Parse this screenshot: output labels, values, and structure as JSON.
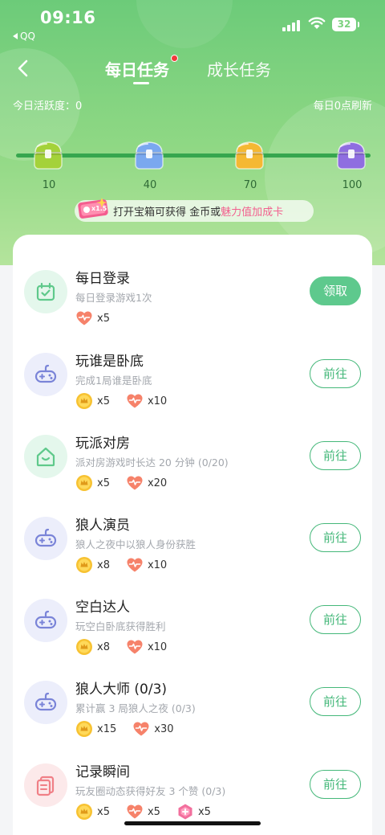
{
  "status_bar": {
    "time": "09:16",
    "back_app": "QQ",
    "battery": "32"
  },
  "nav": {
    "back_icon": "chevron-left-icon",
    "tabs": [
      {
        "label": "每日任务",
        "active": true,
        "badge_dot": true
      },
      {
        "label": "成长任务",
        "active": false
      }
    ]
  },
  "activity": {
    "label": "今日活跃度：0",
    "refresh": "每日0点刷新"
  },
  "progress": {
    "value": 0,
    "milestones": [
      {
        "value": "10",
        "chest_color": "#a4d23a"
      },
      {
        "value": "40",
        "chest_color": "#7aa8ef"
      },
      {
        "value": "70",
        "chest_color": "#f5b833"
      },
      {
        "value": "100",
        "chest_color": "#8f6ee0"
      }
    ]
  },
  "promo": {
    "card_text": "x1.5",
    "prefix": "打开宝箱可获得 金币或",
    "highlight": "魅力值加成卡"
  },
  "tasks": [
    {
      "title": "每日登录",
      "desc": "每日登录游戏1次",
      "icon": "calendar-icon",
      "icon_bg": "#e4f7ec",
      "icon_color": "#5fc98b",
      "button": "领取",
      "button_type": "claim",
      "rewards": [
        {
          "type": "heart",
          "count": "x5"
        }
      ]
    },
    {
      "title": "玩谁是卧底",
      "desc": "完成1局谁是卧底",
      "icon": "gamepad-icon",
      "icon_bg": "#eceefb",
      "icon_color": "#7a84d8",
      "button": "前往",
      "button_type": "go",
      "rewards": [
        {
          "type": "coin",
          "count": "x5"
        },
        {
          "type": "heart",
          "count": "x10"
        }
      ]
    },
    {
      "title": "玩派对房",
      "desc": "派对房游戏时长达 20 分钟 (0/20)",
      "icon": "house-icon",
      "icon_bg": "#e4f7ec",
      "icon_color": "#5fc98b",
      "button": "前往",
      "button_type": "go",
      "rewards": [
        {
          "type": "coin",
          "count": "x5"
        },
        {
          "type": "heart",
          "count": "x20"
        }
      ]
    },
    {
      "title": "狼人演员",
      "desc": "狼人之夜中以狼人身份获胜",
      "icon": "gamepad-icon",
      "icon_bg": "#eceefb",
      "icon_color": "#7a84d8",
      "button": "前往",
      "button_type": "go",
      "rewards": [
        {
          "type": "coin",
          "count": "x8"
        },
        {
          "type": "heart",
          "count": "x10"
        }
      ]
    },
    {
      "title": "空白达人",
      "desc": "玩空白卧底获得胜利",
      "icon": "gamepad-icon",
      "icon_bg": "#eceefb",
      "icon_color": "#7a84d8",
      "button": "前往",
      "button_type": "go",
      "rewards": [
        {
          "type": "coin",
          "count": "x8"
        },
        {
          "type": "heart",
          "count": "x10"
        }
      ]
    },
    {
      "title": "狼人大师 (0/3)",
      "desc": "累计赢 3 局狼人之夜 (0/3)",
      "icon": "gamepad-icon",
      "icon_bg": "#eceefb",
      "icon_color": "#7a84d8",
      "button": "前往",
      "button_type": "go",
      "rewards": [
        {
          "type": "coin",
          "count": "x15"
        },
        {
          "type": "heart",
          "count": "x30"
        }
      ]
    },
    {
      "title": "记录瞬间",
      "desc": "玩友圈动态获得好友 3 个赞 (0/3)",
      "icon": "document-icon",
      "icon_bg": "#fce9ea",
      "icon_color": "#f07f86",
      "button": "前往",
      "button_type": "go",
      "rewards": [
        {
          "type": "coin",
          "count": "x5"
        },
        {
          "type": "heart",
          "count": "x5"
        },
        {
          "type": "gem",
          "count": "x5"
        }
      ]
    }
  ]
}
